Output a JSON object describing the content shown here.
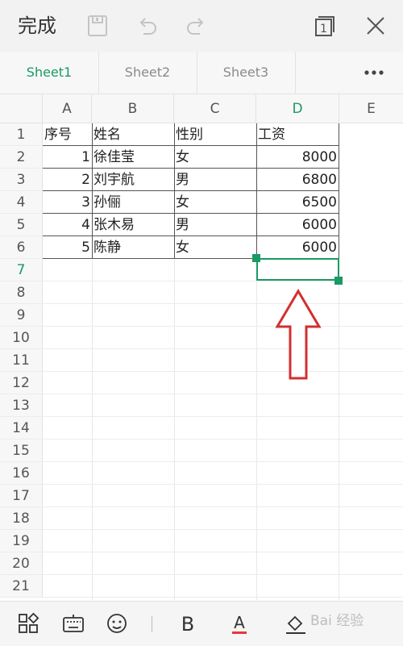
{
  "toolbar": {
    "done_label": "完成",
    "icons": [
      "save-icon",
      "undo-icon",
      "redo-icon",
      "window-count-icon",
      "close-icon"
    ],
    "window_count": "1"
  },
  "sheets": {
    "tabs": [
      "Sheet1",
      "Sheet2",
      "Sheet3"
    ],
    "active": "Sheet1",
    "more_icon": "more-icon"
  },
  "grid": {
    "columns": [
      "A",
      "B",
      "C",
      "D",
      "E"
    ],
    "selected_column": "D",
    "rows": [
      "1",
      "2",
      "3",
      "4",
      "5",
      "6",
      "7",
      "8",
      "9",
      "10",
      "11",
      "12",
      "13",
      "14",
      "15",
      "16",
      "17",
      "18",
      "19",
      "20",
      "21"
    ],
    "selected_row": "7",
    "cells": [
      [
        "序号",
        "姓名",
        "性别",
        "工资"
      ],
      [
        "1",
        "徐佳莹",
        "女",
        "8000"
      ],
      [
        "2",
        "刘宇航",
        "男",
        "6800"
      ],
      [
        "3",
        "孙俪",
        "女",
        "6500"
      ],
      [
        "4",
        "张木易",
        "男",
        "6000"
      ],
      [
        "5",
        "陈静",
        "女",
        "6000"
      ]
    ],
    "selected_cell": "D7"
  },
  "bottombar": {
    "icons": [
      "apps-icon",
      "keyboard-icon",
      "face-icon",
      "bold-icon",
      "font-color-icon",
      "fill-color-icon"
    ],
    "font_color": "#e53935"
  },
  "watermark": "Bai 经验",
  "colors": {
    "accent": "#1a9a64",
    "arrow": "#d32f2f"
  }
}
